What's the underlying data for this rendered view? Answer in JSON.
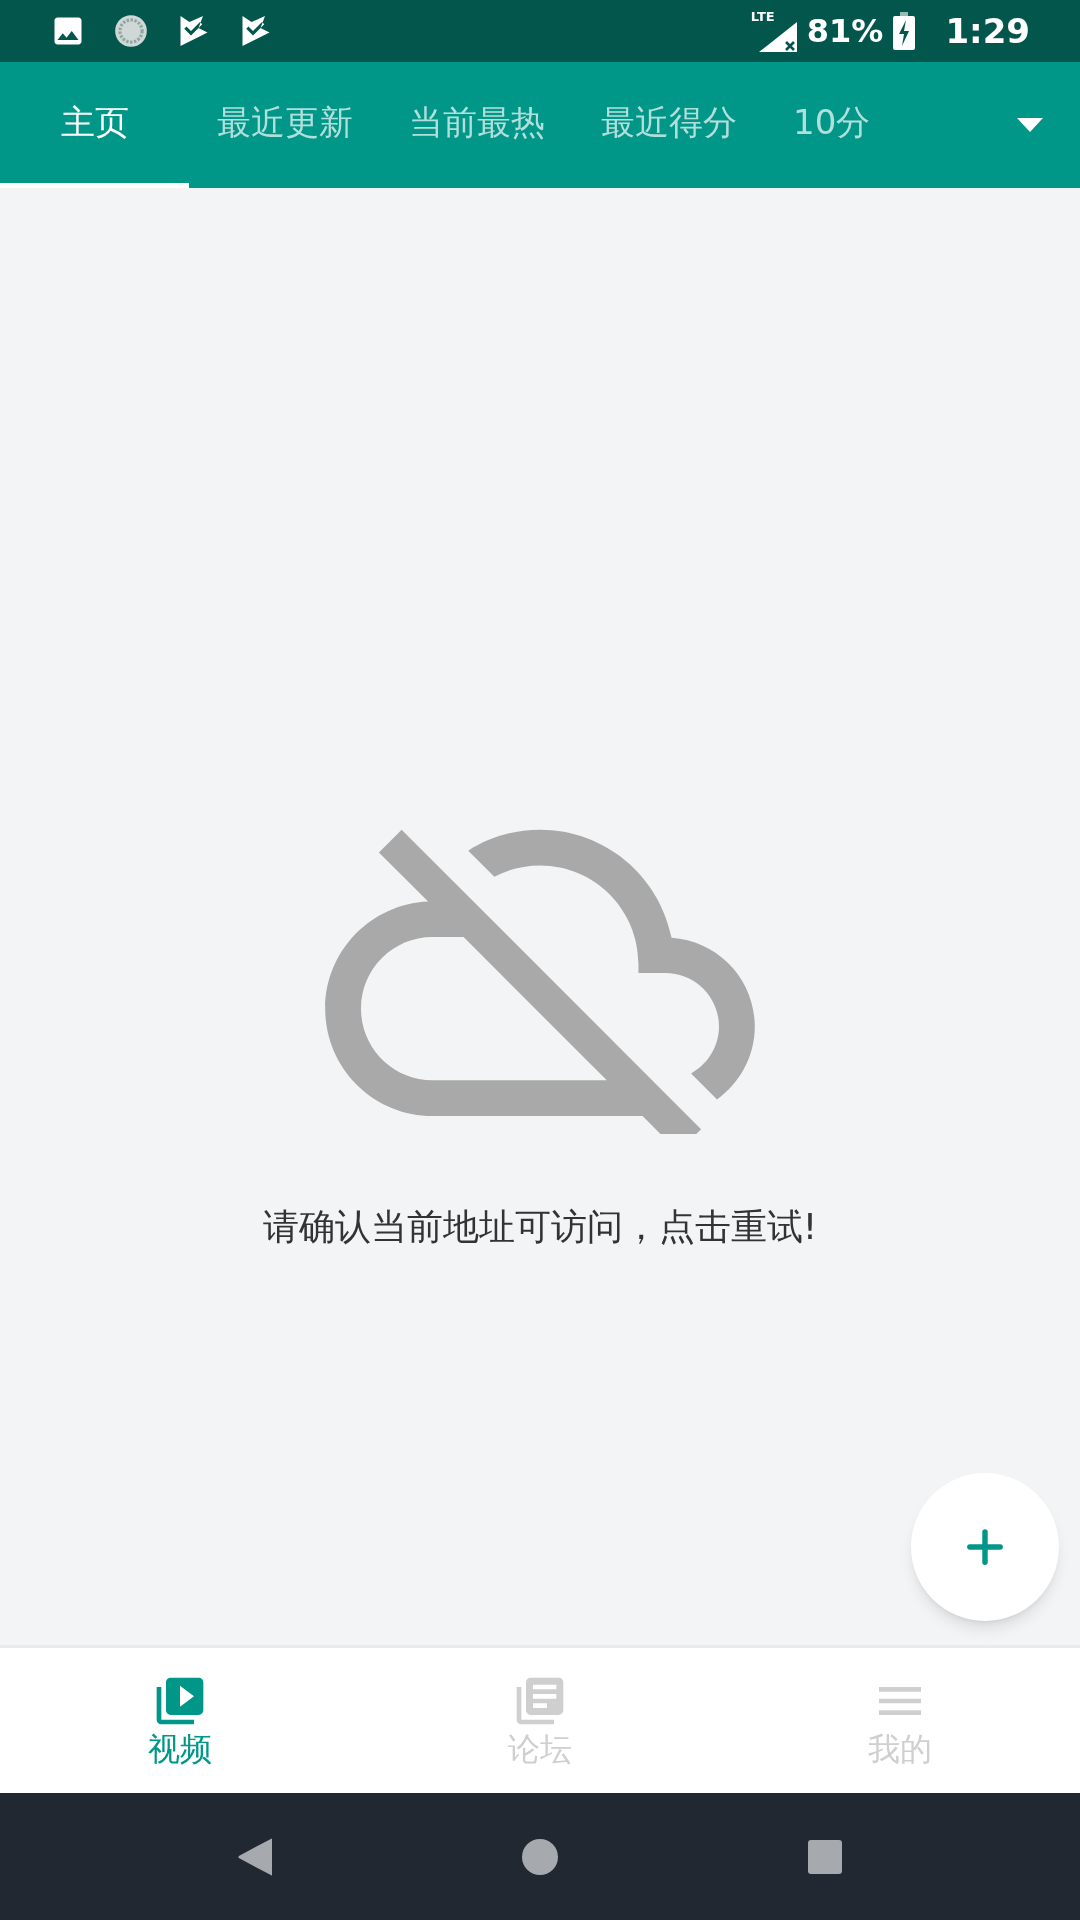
{
  "status_bar": {
    "network": "LTE",
    "battery": "81%",
    "time": "1:29"
  },
  "tabs": [
    {
      "label": "主页",
      "selected": true
    },
    {
      "label": "最近更新",
      "selected": false
    },
    {
      "label": "当前最热",
      "selected": false
    },
    {
      "label": "最近得分",
      "selected": false
    },
    {
      "label": "10分",
      "selected": false
    }
  ],
  "empty_state": {
    "message": "请确认当前地址可访问，点击重试!"
  },
  "bottom_nav": [
    {
      "label": "视频",
      "kind": "video",
      "selected": true
    },
    {
      "label": "论坛",
      "kind": "forum",
      "selected": false
    },
    {
      "label": "我的",
      "kind": "menu",
      "selected": false
    }
  ]
}
